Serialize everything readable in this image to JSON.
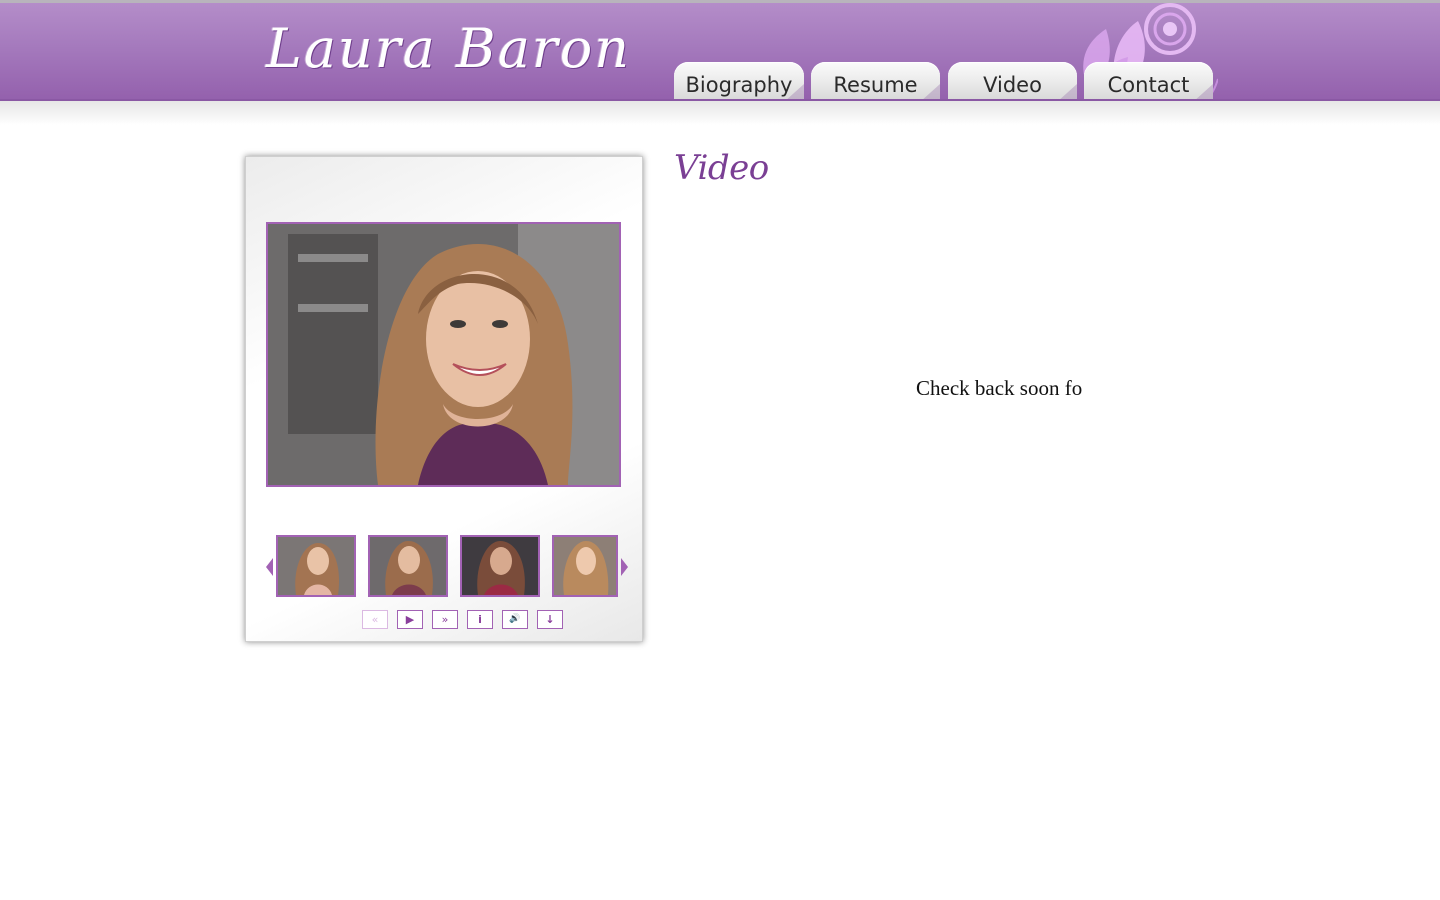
{
  "site": {
    "logo_text": "Laura Baron"
  },
  "nav": {
    "tabs": [
      {
        "label": "Biography"
      },
      {
        "label": "Resume"
      },
      {
        "label": "Video"
      },
      {
        "label": "Contact"
      }
    ]
  },
  "gallery": {
    "controls": [
      {
        "icon": "rewind-icon",
        "glyph": "«",
        "enabled": false
      },
      {
        "icon": "play-icon",
        "glyph": "▶",
        "enabled": true
      },
      {
        "icon": "fast-forward-icon",
        "glyph": "»",
        "enabled": true
      },
      {
        "icon": "info-icon",
        "glyph": "i",
        "enabled": true
      },
      {
        "icon": "sound-icon",
        "glyph": "🔊",
        "enabled": true
      },
      {
        "icon": "download-icon",
        "glyph": "↓",
        "enabled": true
      }
    ],
    "thumbnail_count_visible": 4
  },
  "main": {
    "title": "Video",
    "notice": "Check back soon fo"
  },
  "colors": {
    "brand_purple": "#a57abd",
    "accent_purple": "#a262b4",
    "title_purple": "#7a3f94"
  }
}
